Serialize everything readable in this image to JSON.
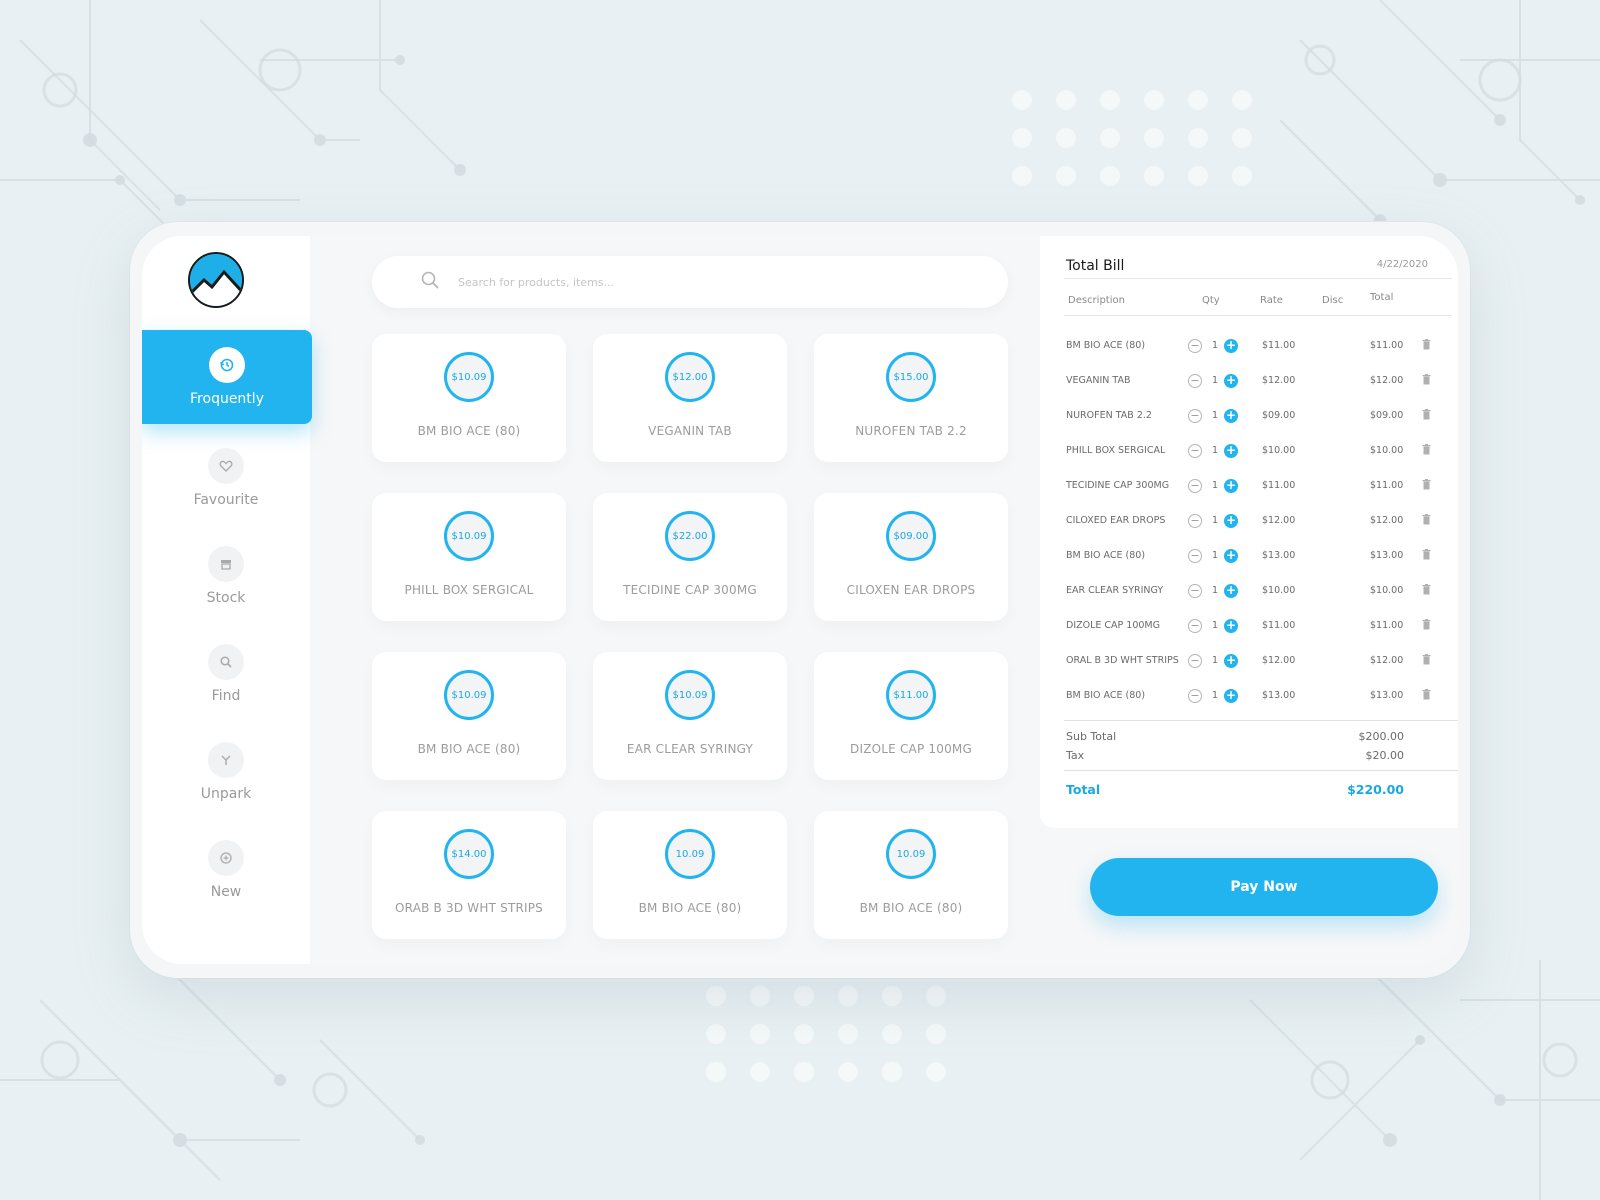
{
  "app": {
    "accent": "#22b4ee",
    "logo_icon": "mountain-logo-icon"
  },
  "sidebar": {
    "items": [
      {
        "label": "Froquently",
        "icon": "history-icon",
        "active": true
      },
      {
        "label": "Favourite",
        "icon": "heart-icon"
      },
      {
        "label": "Stock",
        "icon": "store-icon"
      },
      {
        "label": "Find",
        "icon": "search-icon"
      },
      {
        "label": "Unpark",
        "icon": "merge-icon"
      },
      {
        "label": "New",
        "icon": "plus-circle-icon"
      }
    ]
  },
  "search": {
    "placeholder": "Search for products, items...",
    "icon": "search-icon"
  },
  "products": [
    {
      "price": "$10.09",
      "name": "BM BIO ACE (80)"
    },
    {
      "price": "$12.00",
      "name": "VEGANIN TAB"
    },
    {
      "price": "$15.00",
      "name": "NUROFEN TAB 2.2"
    },
    {
      "price": "$10.09",
      "name": "PHILL BOX SERGICAL"
    },
    {
      "price": "$22.00",
      "name": "TECIDINE CAP 300MG"
    },
    {
      "price": "$09.00",
      "name": "CILOXEN EAR DROPS"
    },
    {
      "price": "$10.09",
      "name": "BM BIO ACE (80)"
    },
    {
      "price": "$10.09",
      "name": "EAR CLEAR SYRINGY"
    },
    {
      "price": "$11.00",
      "name": "DIZOLE CAP 100MG"
    },
    {
      "price": "$14.00",
      "name": "ORAB B 3D WHT STRIPS"
    },
    {
      "price": "10.09",
      "name": "BM BIO ACE (80)"
    },
    {
      "price": "10.09",
      "name": "BM BIO ACE (80)"
    }
  ],
  "bill": {
    "title": "Total Bill",
    "date": "4/22/2020",
    "columns": {
      "description": "Description",
      "qty": "Qty",
      "rate": "Rate",
      "disc": "Disc",
      "total": "Total"
    },
    "rows": [
      {
        "desc": "BM BIO ACE (80)",
        "qty": "1",
        "rate": "$11.00",
        "total": "$11.00"
      },
      {
        "desc": "VEGANIN TAB",
        "qty": "1",
        "rate": "$12.00",
        "total": "$12.00"
      },
      {
        "desc": "NUROFEN TAB 2.2",
        "qty": "1",
        "rate": "$09.00",
        "total": "$09.00"
      },
      {
        "desc": "PHILL BOX SERGICAL",
        "qty": "1",
        "rate": "$10.00",
        "total": "$10.00"
      },
      {
        "desc": "TECIDINE CAP 300MG",
        "qty": "1",
        "rate": "$11.00",
        "total": "$11.00"
      },
      {
        "desc": "CILOXED EAR DROPS",
        "qty": "1",
        "rate": "$12.00",
        "total": "$12.00"
      },
      {
        "desc": "BM BIO ACE (80)",
        "qty": "1",
        "rate": "$13.00",
        "total": "$13.00"
      },
      {
        "desc": "EAR CLEAR SYRINGY",
        "qty": "1",
        "rate": "$10.00",
        "total": "$10.00"
      },
      {
        "desc": "DIZOLE CAP 100MG",
        "qty": "1",
        "rate": "$11.00",
        "total": "$11.00"
      },
      {
        "desc": "ORAL B 3D WHT STRIPS",
        "qty": "1",
        "rate": "$12.00",
        "total": "$12.00"
      },
      {
        "desc": "BM BIO ACE (80)",
        "qty": "1",
        "rate": "$13.00",
        "total": "$13.00"
      }
    ],
    "subtotal_label": "Sub Total",
    "subtotal": "$200.00",
    "tax_label": "Tax",
    "tax": "$20.00",
    "total_label": "Total",
    "total": "$220.00"
  },
  "pay_button": {
    "label": "Pay Now"
  }
}
